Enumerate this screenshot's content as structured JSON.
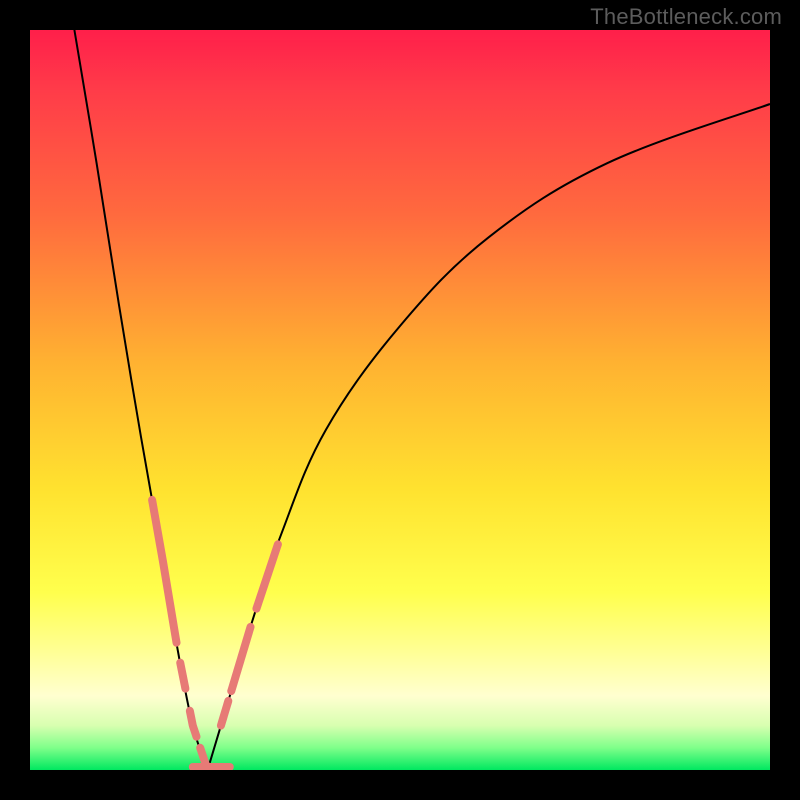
{
  "watermark": "TheBottleneck.com",
  "colors": {
    "accent": "#e77a76",
    "curve": "#000000",
    "frame": "#000000"
  },
  "chart_data": {
    "type": "line",
    "title": "",
    "xlabel": "",
    "ylabel": "",
    "xlim": [
      0,
      100
    ],
    "ylim": [
      0,
      100
    ],
    "grid": false,
    "legend": false,
    "note": "Bottleneck-style V curve. y represents mismatch percentage (top = 100% bad / red, bottom = 0% good / green). Minimum near x≈24.",
    "series": [
      {
        "name": "left-branch",
        "x": [
          6,
          9,
          12,
          15,
          18,
          20,
          22,
          24
        ],
        "y": [
          100,
          82,
          63,
          45,
          28,
          16,
          6,
          0
        ]
      },
      {
        "name": "right-branch",
        "x": [
          24,
          27,
          30,
          34,
          40,
          50,
          62,
          78,
          100
        ],
        "y": [
          0,
          10,
          20,
          32,
          46,
          60,
          72,
          82,
          90
        ]
      }
    ],
    "accent_segments": {
      "note": "Salmon highlighted dashes near the minimum on both branches and along the bottom.",
      "left_branch_x_ranges": [
        [
          16.5,
          19.8
        ],
        [
          20.3,
          21.0
        ],
        [
          21.6,
          22.5
        ],
        [
          23.0,
          23.8
        ]
      ],
      "right_branch_x_ranges": [
        [
          25.8,
          26.8
        ],
        [
          27.2,
          29.8
        ],
        [
          30.6,
          33.5
        ]
      ],
      "bottom_x_range": [
        22.0,
        27.0
      ]
    }
  }
}
